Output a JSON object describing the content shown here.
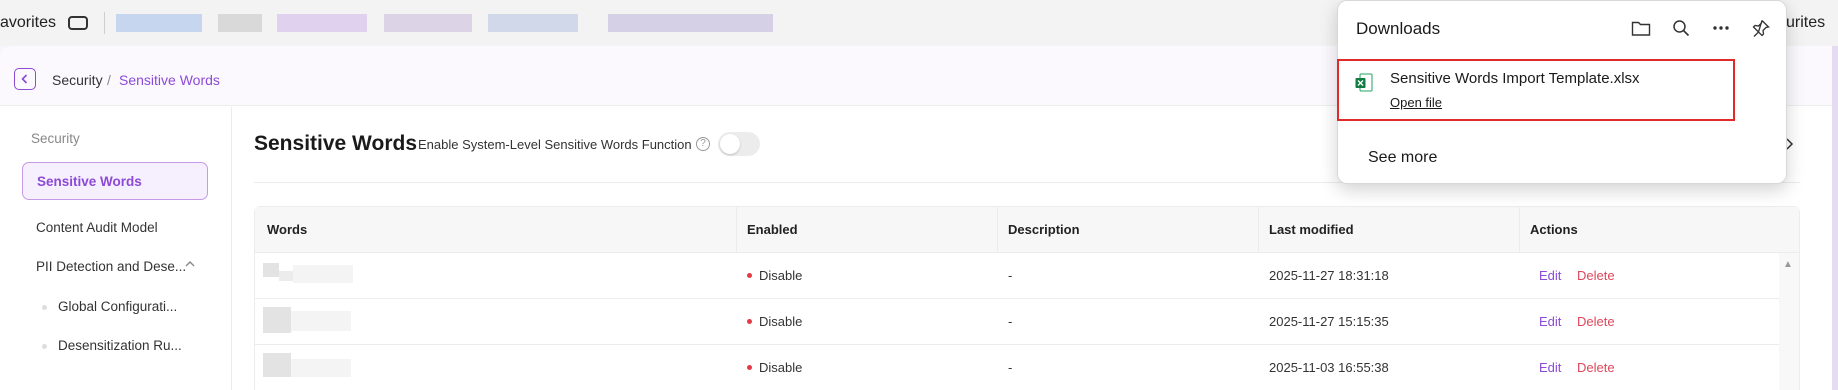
{
  "browser": {
    "favorites_left_label": "avorites",
    "favorites_right_label": "urites"
  },
  "breadcrumb": {
    "parent": "Security",
    "separator": "/",
    "current": "Sensitive Words"
  },
  "sidebar": {
    "group_label": "Security",
    "items": [
      {
        "label": "Sensitive Words"
      },
      {
        "label": "Content Audit Model"
      },
      {
        "label": "PII Detection and Dese..."
      }
    ],
    "sub_items": [
      {
        "label": "Global Configurati..."
      },
      {
        "label": "Desensitization Ru..."
      }
    ]
  },
  "main": {
    "title": "Sensitive Words",
    "toggle_label": "Enable System-Level Sensitive Words Function",
    "help_icon": "?",
    "toggle_on": false
  },
  "table": {
    "headers": [
      "Words",
      "Enabled",
      "Description",
      "Last modified",
      "Actions"
    ],
    "rows": [
      {
        "status": "Disable",
        "description": "-",
        "modified": "2025-11-27 18:31:18",
        "edit": "Edit",
        "delete": "Delete"
      },
      {
        "status": "Disable",
        "description": "-",
        "modified": "2025-11-27 15:15:35",
        "edit": "Edit",
        "delete": "Delete"
      },
      {
        "status": "Disable",
        "description": "-",
        "modified": "2025-11-03 16:55:38",
        "edit": "Edit",
        "delete": "Delete"
      }
    ]
  },
  "downloads": {
    "title": "Downloads",
    "file_name": "Sensitive Words Import Template.xlsx",
    "open_label": "Open file",
    "see_more": "See more"
  },
  "colors": {
    "accent": "#8c4ad6",
    "danger": "#e0475b",
    "highlight": "#e12b2b"
  }
}
